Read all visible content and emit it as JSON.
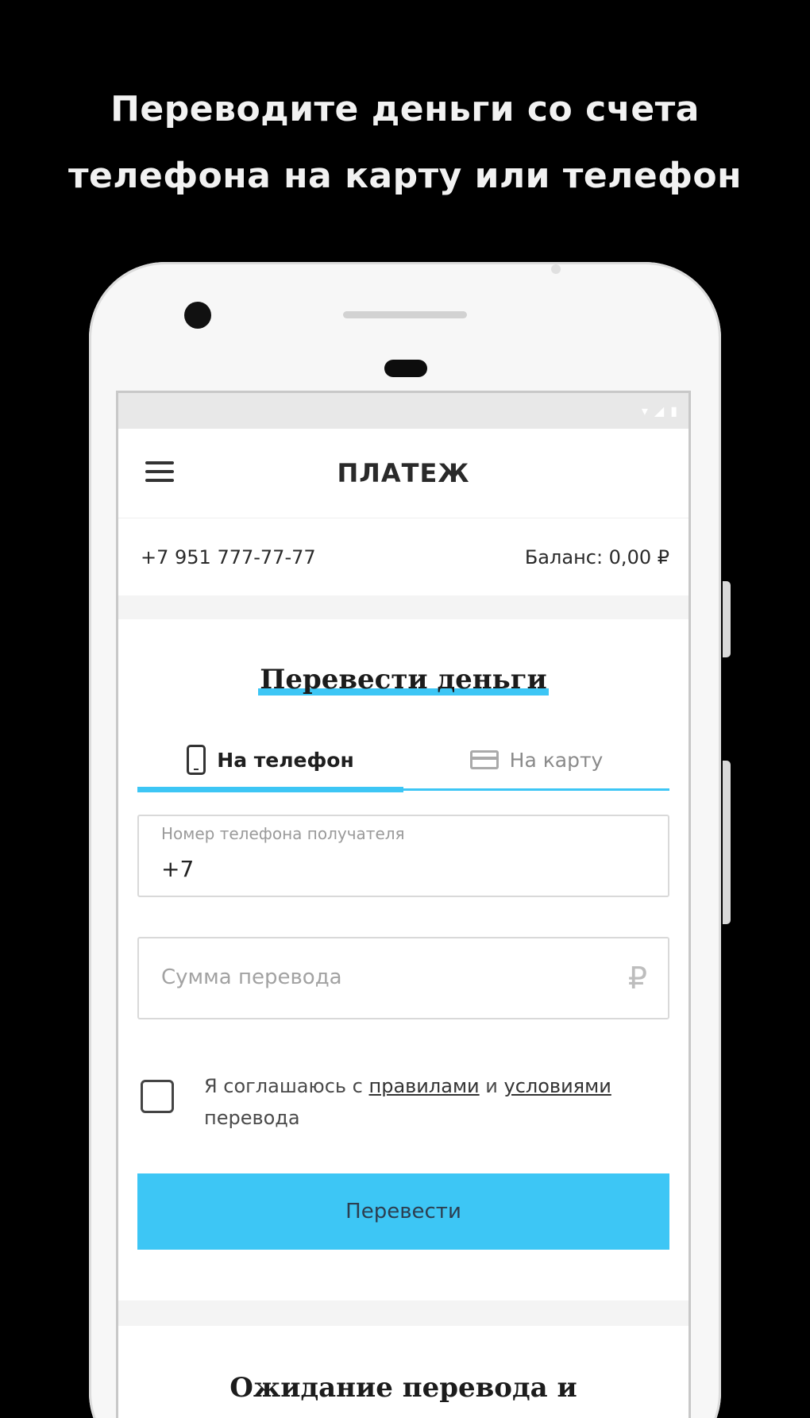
{
  "promo": {
    "line1": "Переводите деньги со счета",
    "line2": "телефона на карту или телефон"
  },
  "appbar": {
    "title": "ПЛАТЕЖ",
    "menu_icon": "hamburger-menu-icon"
  },
  "account": {
    "phone": "+7 951 777-77-77",
    "balance": "Баланс: 0,00 ₽"
  },
  "transfer": {
    "title": "Перевести деньги",
    "tabs": [
      {
        "label": "На телефон",
        "icon": "phone-icon",
        "active": true
      },
      {
        "label": "На карту",
        "icon": "card-icon",
        "active": false
      }
    ],
    "recipient_field": {
      "label": "Номер телефона получателя",
      "value": "+7"
    },
    "amount_field": {
      "placeholder": "Сумма перевода",
      "currency_symbol": "₽"
    },
    "agreement": {
      "prefix": "Я соглашаюсь с ",
      "link1": "правилами",
      "middle": " и ",
      "link2": "условиями",
      "suffix": "перевода",
      "checked": false
    },
    "submit_label": "Перевести"
  },
  "next_section": {
    "title": "Ожидание перевода и"
  },
  "colors": {
    "accent": "#3dc6f5",
    "background": "#000000",
    "screen": "#ffffff"
  }
}
